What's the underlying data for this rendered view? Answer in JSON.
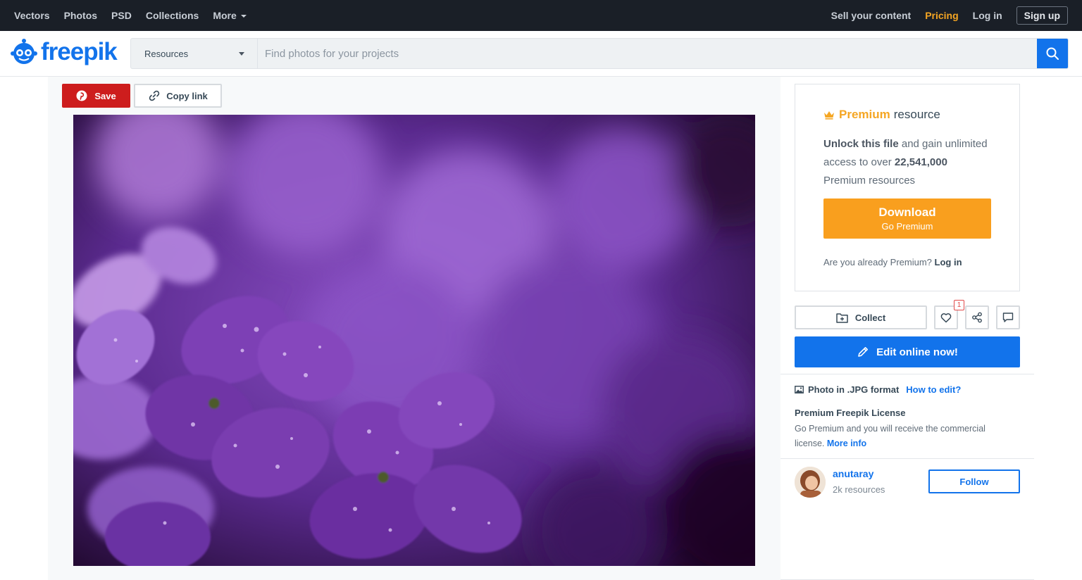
{
  "topnav": {
    "links": [
      "Vectors",
      "Photos",
      "PSD",
      "Collections",
      "More"
    ],
    "sell": "Sell your content",
    "pricing": "Pricing",
    "login": "Log in",
    "signup": "Sign up"
  },
  "header": {
    "logo_text": "freepik",
    "search_category": "Resources",
    "search_placeholder": "Find photos for your projects"
  },
  "toolbar": {
    "save_label": "Save",
    "copy_label": "Copy link"
  },
  "premium": {
    "title_highlight": "Premium",
    "title_rest": "resource",
    "desc_bold1": "Unlock this file",
    "desc_mid": " and gain unlimited access to over ",
    "desc_bold2": "22,541,000",
    "desc_end": " Premium resources",
    "download_label": "Download",
    "download_sub": "Go Premium",
    "already_text": "Are you already Premium?",
    "already_link": "Log in"
  },
  "actions": {
    "collect_label": "Collect",
    "like_count": "1"
  },
  "edit": {
    "label": "Edit online now!"
  },
  "info": {
    "format": "Photo in .JPG format",
    "how_to": "How to edit?",
    "license_title": "Premium Freepik License",
    "license_desc": "Go Premium and you will receive the commercial license.",
    "license_more": "More info"
  },
  "author": {
    "name": "anutaray",
    "resources": "2k resources",
    "follow_label": "Follow"
  },
  "colors": {
    "brand_blue": "#1273eb",
    "save_red": "#cd1d1d",
    "premium_orange": "#f99f1e",
    "topbar_bg": "#1a1f27"
  }
}
